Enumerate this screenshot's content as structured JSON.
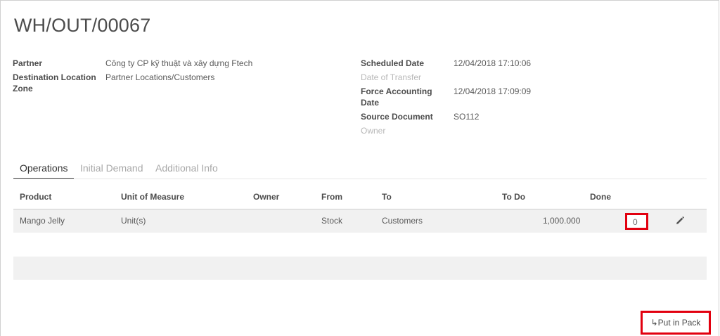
{
  "record": {
    "title": "WH/OUT/00067"
  },
  "left_fields": [
    {
      "label": "Partner",
      "value": "Công ty CP kỹ thuật và xây dựng Ftech"
    },
    {
      "label": "Destination Location",
      "label2": "Zone",
      "value": "Partner Locations/Customers"
    }
  ],
  "right_fields": {
    "scheduled_date": {
      "label": "Scheduled Date",
      "value": "12/04/2018 17:10:06"
    },
    "date_of_transfer": {
      "label": "Date of Transfer",
      "value": ""
    },
    "force_accounting": {
      "label": "Force Accounting",
      "label2": "Date",
      "value": "12/04/2018 17:09:09"
    },
    "source_document": {
      "label": "Source Document",
      "value": "SO112"
    },
    "owner": {
      "label": "Owner",
      "value": ""
    }
  },
  "tabs": [
    {
      "label": "Operations",
      "active": true
    },
    {
      "label": "Initial Demand",
      "active": false
    },
    {
      "label": "Additional Info",
      "active": false
    }
  ],
  "table": {
    "columns": [
      "Product",
      "Unit of Measure",
      "Owner",
      "From",
      "To",
      "To Do",
      "Done"
    ],
    "rows": [
      {
        "product": "Mango Jelly",
        "uom": "Unit(s)",
        "owner": "",
        "from": "Stock",
        "to": "Customers",
        "todo": "1,000.000",
        "done": "0"
      }
    ]
  },
  "actions": {
    "put_in_pack": "Put in Pack"
  },
  "icons": {
    "edit": "pencil-icon",
    "pack": "cursor-pack-icon"
  },
  "colors": {
    "highlight": "#e2000f",
    "row_bg": "#f1f1f1",
    "muted": "#b8b8b8"
  }
}
